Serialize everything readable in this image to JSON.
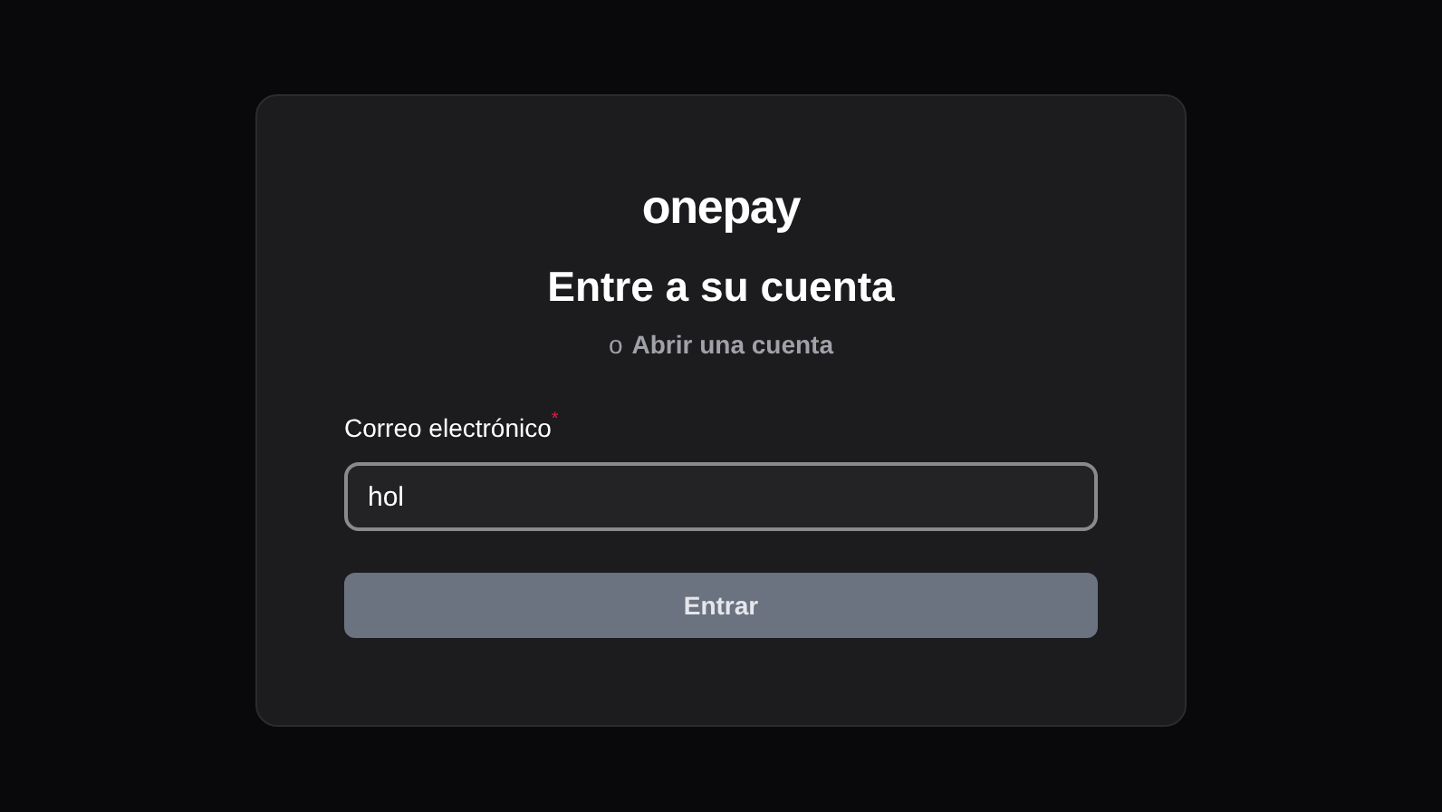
{
  "logo": "onepay",
  "title": "Entre a su cuenta",
  "subtitle": {
    "prefix": "o",
    "link": "Abrir una cuenta"
  },
  "email": {
    "label": "Correo electrónico",
    "required_mark": "*",
    "value": "hol"
  },
  "submit": {
    "label": "Entrar",
    "disabled": true
  }
}
